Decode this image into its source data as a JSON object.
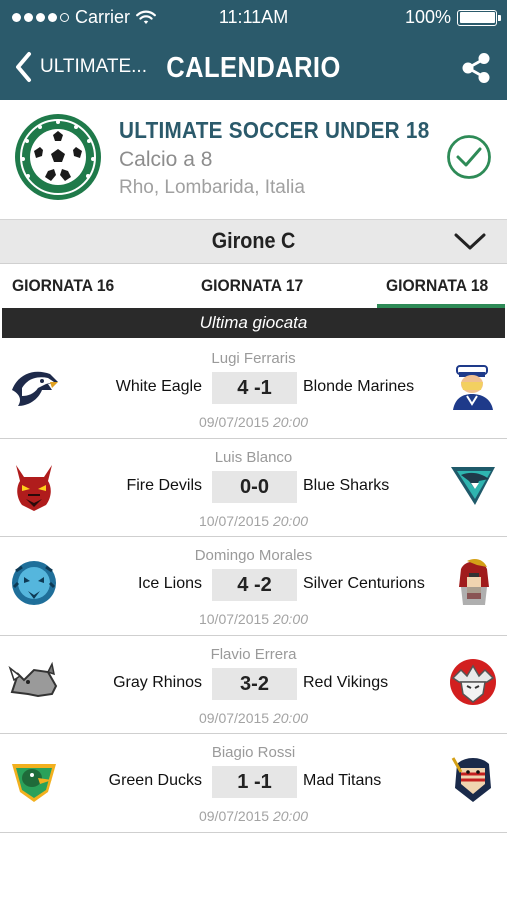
{
  "status_bar": {
    "carrier": "Carrier",
    "time": "11:11AM",
    "battery": "100%"
  },
  "nav": {
    "back_label": "ULTIMATE...",
    "title": "CALENDARIO"
  },
  "team": {
    "name": "ULTIMATE SOCCER UNDER 18",
    "sport": "Calcio a 8",
    "location": "Rho, Lombarida, Italia"
  },
  "group": {
    "title": "Girone C"
  },
  "tabs": [
    {
      "label": "GIORNATA 16"
    },
    {
      "label": "GIORNATA 17"
    },
    {
      "label": "GIORNATA 18",
      "selected": true
    }
  ],
  "played_label": "Ultima giocata",
  "matches": [
    {
      "venue": "Lugi Ferraris",
      "home": "White Eagle",
      "score": "4 -1",
      "away": "Blonde Marines",
      "date": "09/07/2015",
      "time": "20:00",
      "home_logo": "eagle-icon",
      "away_logo": "marine-icon"
    },
    {
      "venue": "Luis Blanco",
      "home": "Fire Devils",
      "score": "0-0",
      "away": "Blue Sharks",
      "date": "10/07/2015",
      "time": "20:00",
      "home_logo": "devil-icon",
      "away_logo": "shark-icon"
    },
    {
      "venue": "Domingo Morales",
      "home": "Ice Lions",
      "score": "4 -2",
      "away": "Silver Centurions",
      "date": "10/07/2015",
      "time": "20:00",
      "home_logo": "lion-icon",
      "away_logo": "centurion-icon"
    },
    {
      "venue": "Flavio Errera",
      "home": "Gray Rhinos",
      "score": "3-2",
      "away": "Red Vikings",
      "date": "09/07/2015",
      "time": "20:00",
      "home_logo": "rhino-icon",
      "away_logo": "viking-icon"
    },
    {
      "venue": "Biagio Rossi",
      "home": "Green Ducks",
      "score": "1 -1",
      "away": "Mad Titans",
      "date": "09/07/2015",
      "time": "20:00",
      "home_logo": "duck-icon",
      "away_logo": "titan-icon"
    }
  ],
  "colors": {
    "header_bg": "#2b5a6b",
    "accent_green": "#2e8b57",
    "team_name": "#2b5a6b",
    "played_bar": "#2a2a2a"
  }
}
